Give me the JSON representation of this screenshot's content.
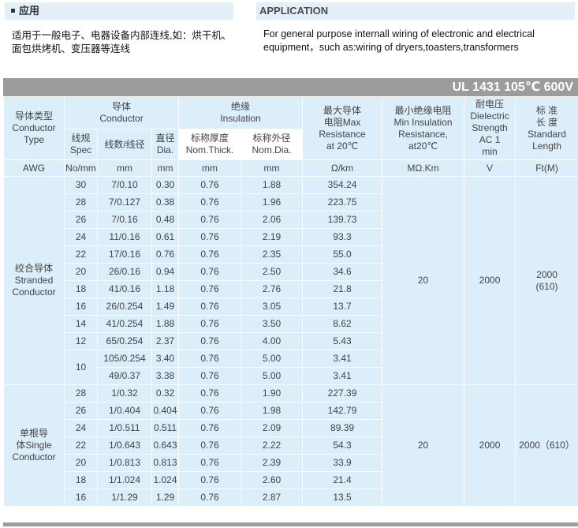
{
  "sections": {
    "left_title": "应用",
    "right_title": "APPLICATION",
    "left_desc": "适用于一般电子、电器设备内部连线,如：烘干机、面包烘烤机、变压器等连线",
    "right_desc": "For general purpose internall wiring of electronic and electrical equipment，such as:wiring of dryers,toasters,transformers"
  },
  "table": {
    "title": "UL 1431 105℃ 600V",
    "headers": {
      "type": [
        "导体类型",
        "Conductor",
        "Type"
      ],
      "conductor": [
        "导体",
        "Conductor"
      ],
      "insulation": [
        "绝缘",
        "Insulation"
      ],
      "max_res": [
        "最大导体",
        "电阻Max",
        "Resistance",
        "at 20℃"
      ],
      "min_ins": [
        "最小绝缘电阻",
        "Min Insulation",
        "Resistance,",
        "at20℃"
      ],
      "dielectric": [
        "耐电压",
        "Dielectric",
        "Strength",
        "AC 1",
        "min"
      ],
      "length": [
        "标 准",
        "长 度",
        "Standard",
        "Length"
      ],
      "spec": [
        "线规",
        "Spec"
      ],
      "strands": "线数/线径",
      "dia": [
        "直径",
        "Dia."
      ],
      "nom_thick": [
        "标称厚度",
        "Nom.Thick."
      ],
      "nom_dia": [
        "标称外径",
        "Nom.Dia."
      ]
    },
    "units": [
      "AWG",
      "No/mm",
      "mm",
      "mm",
      "mm",
      "Ω/km",
      "MΩ.Km",
      "V",
      "Ft(M)"
    ],
    "stranded": {
      "label": [
        "绞合导体",
        "Stranded",
        "Conductor"
      ],
      "min_ins": "20",
      "dielectric": "2000",
      "length": [
        "2000",
        "(610)"
      ],
      "rows": [
        {
          "awg": "30",
          "strand": "7/0.10",
          "dia": "0.30",
          "thick": "0.76",
          "od": "1.88",
          "res": "354.24"
        },
        {
          "awg": "28",
          "strand": "7/0.127",
          "dia": "0.38",
          "thick": "0.76",
          "od": "1.96",
          "res": "223.75"
        },
        {
          "awg": "26",
          "strand": "7/0.16",
          "dia": "0.48",
          "thick": "0.76",
          "od": "2.06",
          "res": "139.73"
        },
        {
          "awg": "24",
          "strand": "11/0.16",
          "dia": "0.61",
          "thick": "0.76",
          "od": "2.19",
          "res": "93.3"
        },
        {
          "awg": "22",
          "strand": "17/0.16",
          "dia": "0.76",
          "thick": "0.76",
          "od": "2.35",
          "res": "55.0"
        },
        {
          "awg": "20",
          "strand": "26/0.16",
          "dia": "0.94",
          "thick": "0.76",
          "od": "2.50",
          "res": "34.6"
        },
        {
          "awg": "18",
          "strand": "41/0.16",
          "dia": "1.18",
          "thick": "0.76",
          "od": "2.76",
          "res": "21.8"
        },
        {
          "awg": "16",
          "strand": "26/0.254",
          "dia": "1.49",
          "thick": "0.76",
          "od": "3.05",
          "res": "13.7"
        },
        {
          "awg": "14",
          "strand": "41/0.254",
          "dia": "1.88",
          "thick": "0.76",
          "od": "3.50",
          "res": "8.62"
        },
        {
          "awg": "12",
          "strand": "65/0.254",
          "dia": "2.37",
          "thick": "0.76",
          "od": "4.00",
          "res": "5.43"
        },
        {
          "awg": "10",
          "strand": "105/0.254",
          "dia": "3.40",
          "thick": "0.76",
          "od": "5.00",
          "res": "3.41"
        },
        {
          "awg": "",
          "strand": "49/0.37",
          "dia": "3.38",
          "thick": "0.76",
          "od": "5.00",
          "res": "3.41"
        }
      ]
    },
    "single": {
      "label": [
        "单根导",
        "体Single",
        "Conductor"
      ],
      "min_ins": "20",
      "dielectric": "2000",
      "length": "2000（610）",
      "rows": [
        {
          "awg": "28",
          "strand": "1/0.32",
          "dia": "0.32",
          "thick": "0.76",
          "od": "1.90",
          "res": "227.39"
        },
        {
          "awg": "26",
          "strand": "1/0.404",
          "dia": "0.404",
          "thick": "0.76",
          "od": "1.98",
          "res": "142.79"
        },
        {
          "awg": "24",
          "strand": "1/0.511",
          "dia": "0.511",
          "thick": "0.76",
          "od": "2.09",
          "res": "89.39"
        },
        {
          "awg": "22",
          "strand": "1/0.643",
          "dia": "0.643",
          "thick": "0.76",
          "od": "2.22",
          "res": "54.3"
        },
        {
          "awg": "20",
          "strand": "1/0.813",
          "dia": "0.813",
          "thick": "0.76",
          "od": "2.39",
          "res": "33.9"
        },
        {
          "awg": "18",
          "strand": "1/1.024",
          "dia": "1.024",
          "thick": "0.76",
          "od": "2.60",
          "res": "21.4"
        },
        {
          "awg": "16",
          "strand": "1/1.29",
          "dia": "1.29",
          "thick": "0.76",
          "od": "2.87",
          "res": "13.5"
        }
      ]
    }
  }
}
